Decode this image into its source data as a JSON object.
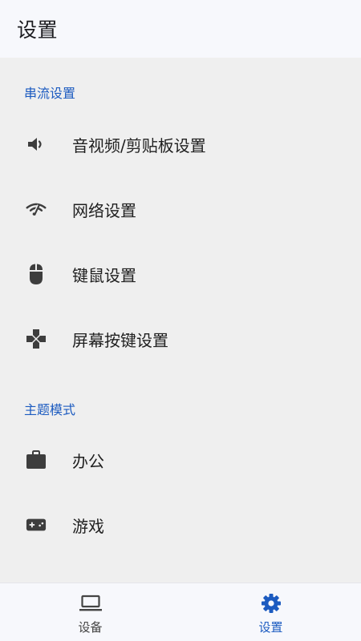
{
  "app_bar": {
    "title": "设置"
  },
  "sections": [
    {
      "header": "串流设置",
      "items": [
        {
          "label": "音视频/剪贴板设置",
          "icon": "volume-icon"
        },
        {
          "label": "网络设置",
          "icon": "network-icon"
        },
        {
          "label": "键鼠设置",
          "icon": "mouse-icon"
        },
        {
          "label": "屏幕按键设置",
          "icon": "gamepad-dpad-icon"
        }
      ]
    },
    {
      "header": "主题模式",
      "items": [
        {
          "label": "办公",
          "icon": "briefcase-icon"
        },
        {
          "label": "游戏",
          "icon": "game-controller-icon"
        }
      ]
    }
  ],
  "bottom_nav": {
    "items": [
      {
        "label": "设备",
        "icon": "laptop-icon",
        "active": false
      },
      {
        "label": "设置",
        "icon": "gear-icon",
        "active": true
      }
    ]
  },
  "colors": {
    "accent": "#1c5bc0",
    "inactive": "#444444",
    "icon": "#3d3d3d",
    "text": "#1f1f1f"
  }
}
